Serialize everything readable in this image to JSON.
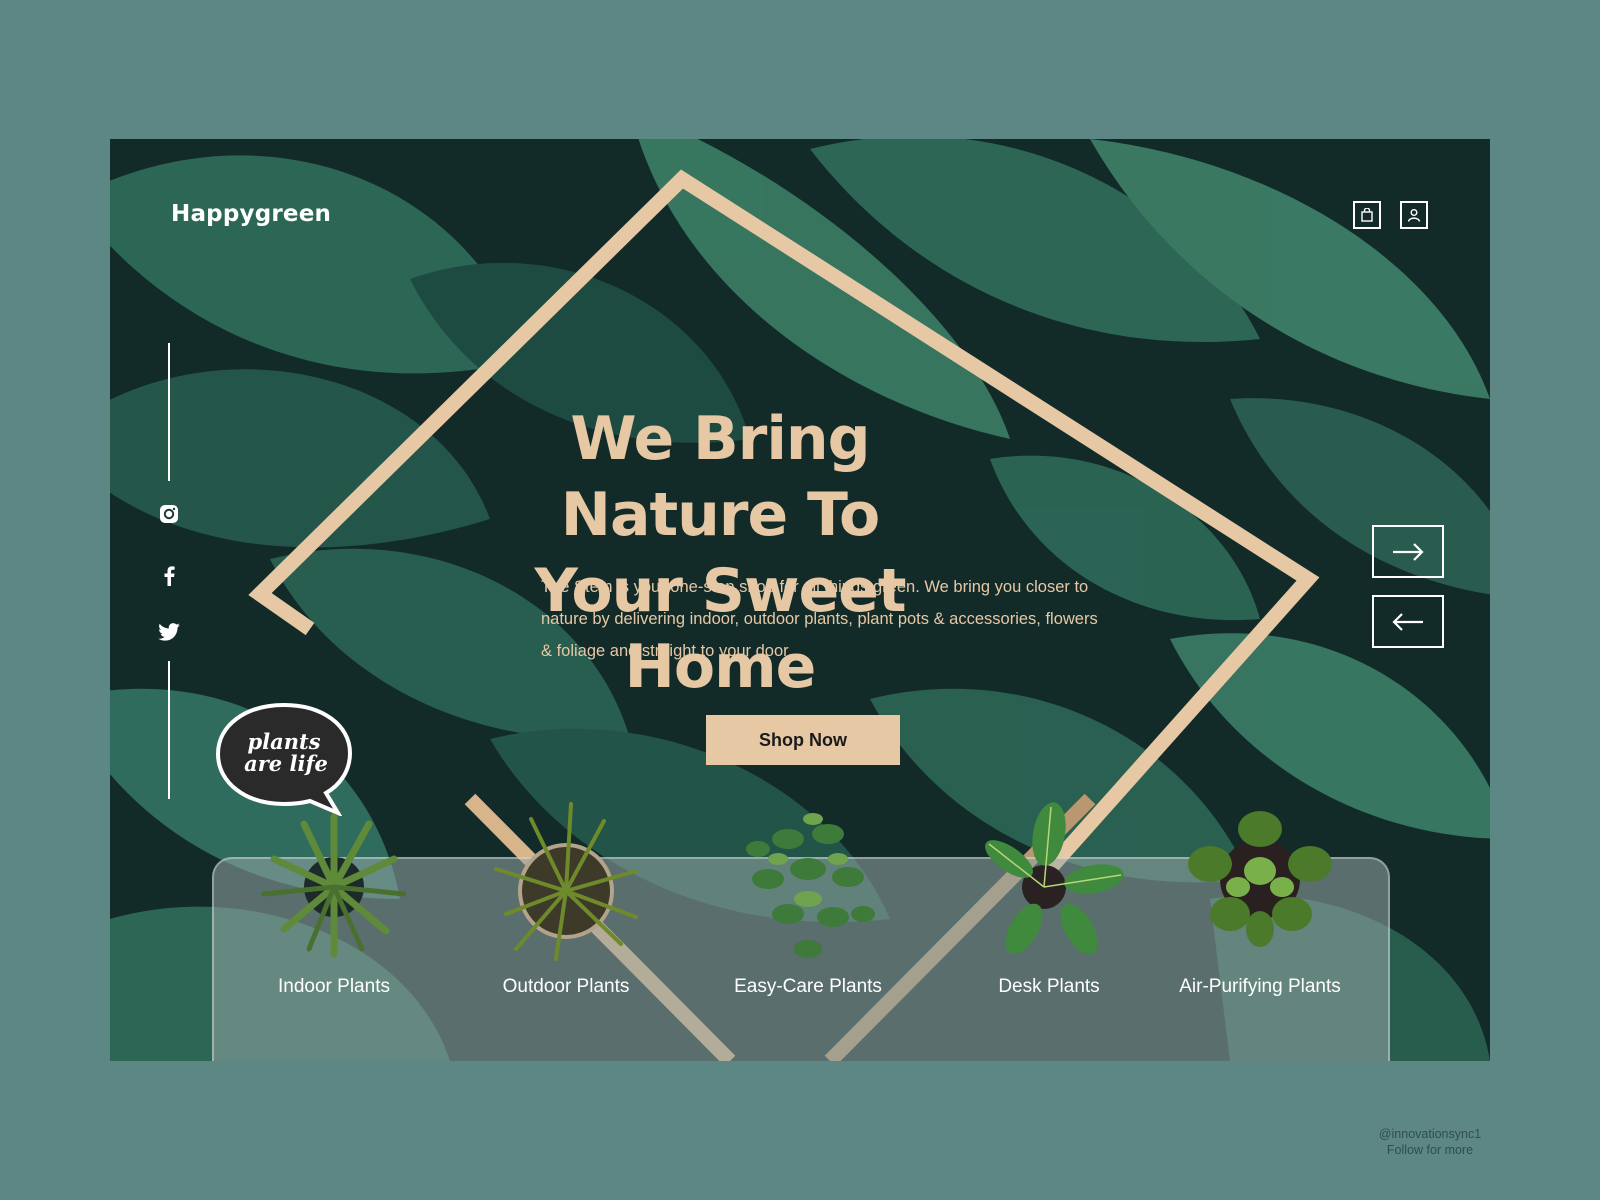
{
  "brand": {
    "name": "Happygreen"
  },
  "header": {
    "icons": [
      "shopping-bag-icon",
      "user-icon"
    ]
  },
  "social": {
    "icons": [
      "instagram-icon",
      "facebook-icon",
      "twitter-icon"
    ]
  },
  "sticker": {
    "line1": "plants",
    "line2": "are life"
  },
  "hero": {
    "title_line1": "We Bring Nature To",
    "title_line2": "Your Sweet Home",
    "description": "The Stem is your one-stop shop for all things green. We bring you closer to nature by delivering indoor, outdoor plants, plant pots & accessories, flowers & foliage and straight to your door.",
    "cta_label": "Shop Now"
  },
  "nav_arrows": [
    "arrow-right-icon",
    "arrow-left-icon"
  ],
  "categories": [
    {
      "label": "Indoor Plants"
    },
    {
      "label": "Outdoor Plants"
    },
    {
      "label": "Easy-Care Plants"
    },
    {
      "label": "Desk Plants"
    },
    {
      "label": "Air-Purifying Plants"
    }
  ],
  "credit": {
    "handle": "@innovationsync1",
    "note": "Follow for more"
  },
  "colors": {
    "page_bg": "#5c8784",
    "accent": "#e6c8a5",
    "leaf_dark": "#1b3f3a",
    "leaf_light": "#3d7a64",
    "white": "#ffffff"
  }
}
